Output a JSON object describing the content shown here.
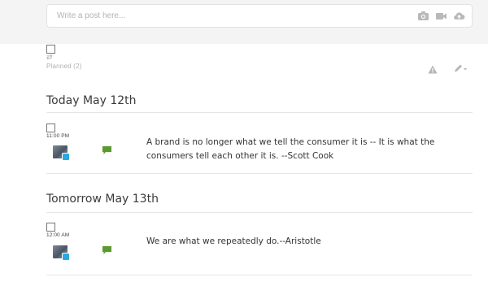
{
  "composer": {
    "placeholder": "Write a post here...",
    "icons": [
      "camera-icon",
      "video-icon",
      "cloud-upload-icon"
    ]
  },
  "toolbar": {
    "reshare_glyph": "⇄",
    "planned_label": "Planned (2)",
    "icons": [
      "warning-icon",
      "pen-dropdown-icon"
    ]
  },
  "days": [
    {
      "heading": "Today May 12th",
      "posts": [
        {
          "time": "11:00 PM",
          "network": "twitter",
          "text": "A brand is no longer what we tell the consumer it is -- It is what the consumers tell each other it is. --Scott Cook"
        }
      ]
    },
    {
      "heading": "Tomorrow May 13th",
      "posts": [
        {
          "time": "12:00 AM",
          "network": "twitter",
          "text": "We are what we repeatedly do.--Aristotle"
        }
      ]
    }
  ],
  "colors": {
    "accent_green": "#5a9a2f",
    "twitter_blue": "#29a9e1",
    "muted": "#b0b0b0"
  }
}
